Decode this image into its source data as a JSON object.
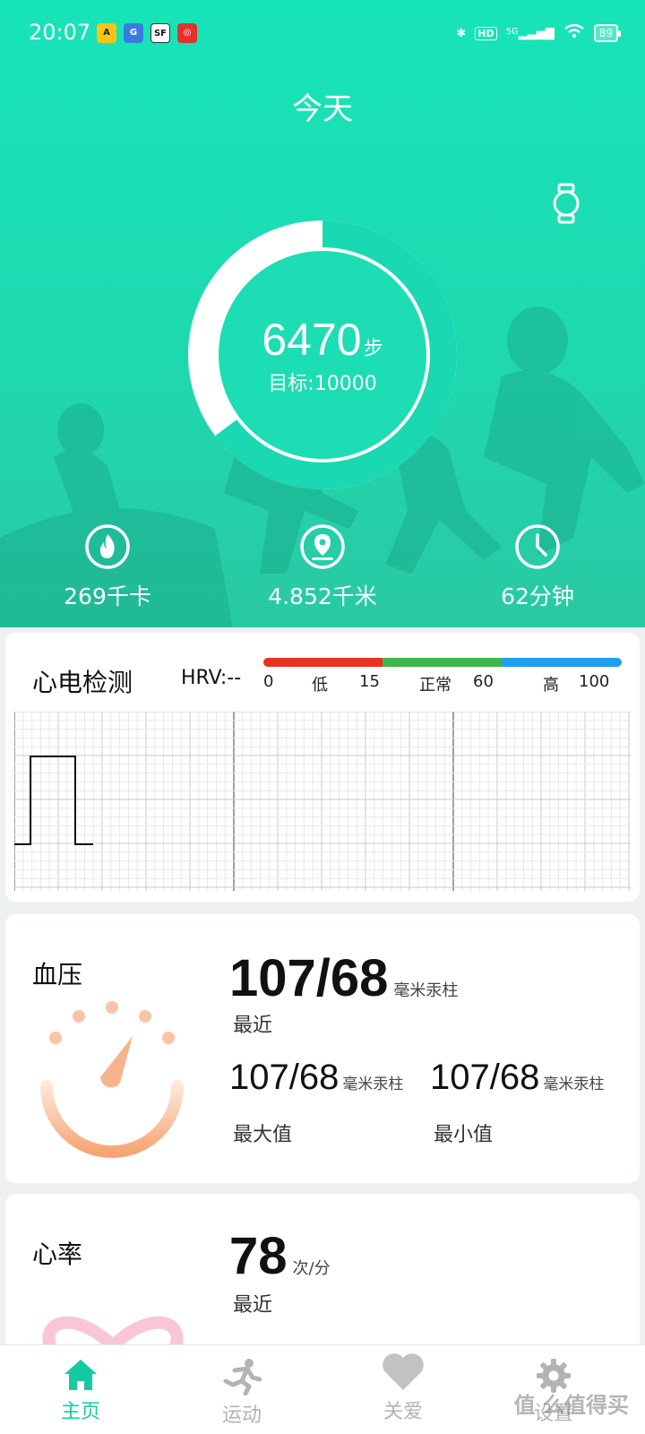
{
  "status_bar": {
    "time": "20:07",
    "hd": "HD",
    "network": "5G",
    "battery": "89"
  },
  "header": {
    "title": "今天"
  },
  "steps": {
    "count": "6470",
    "unit": "步",
    "goal": "目标:10000",
    "progress": 0.647
  },
  "stats": [
    {
      "value": "269千卡",
      "icon": "flame-icon"
    },
    {
      "value": "4.852千米",
      "icon": "location-pin-icon"
    },
    {
      "value": "62分钟",
      "icon": "clock-icon"
    }
  ],
  "ecg": {
    "title": "心电检测",
    "hrv": "HRV:--",
    "scale": {
      "l0": "0",
      "low": "低",
      "l15": "15",
      "normal": "正常",
      "l60": "60",
      "high": "高",
      "l100": "100"
    },
    "colors": {
      "low": "#e8321e",
      "normal": "#3cb84a",
      "high": "#1e9ef0"
    }
  },
  "blood_pressure": {
    "label": "血压",
    "latest_value": "107/68",
    "unit": "毫米汞柱",
    "latest_label": "最近",
    "max_value": "107/68",
    "max_label": "最大值",
    "min_value": "107/68",
    "min_label": "最小值"
  },
  "heart_rate": {
    "label": "心率",
    "value": "78",
    "unit": "次/分",
    "latest_label": "最近"
  },
  "nav": [
    {
      "label": "主页",
      "icon": "home-icon",
      "active": true
    },
    {
      "label": "运动",
      "icon": "running-icon",
      "active": false
    },
    {
      "label": "关爱",
      "icon": "heart-icon",
      "active": false
    },
    {
      "label": "设置",
      "icon": "gear-icon",
      "active": false
    }
  ],
  "watermark": "值 么值得买",
  "accent": "#17c9a3"
}
